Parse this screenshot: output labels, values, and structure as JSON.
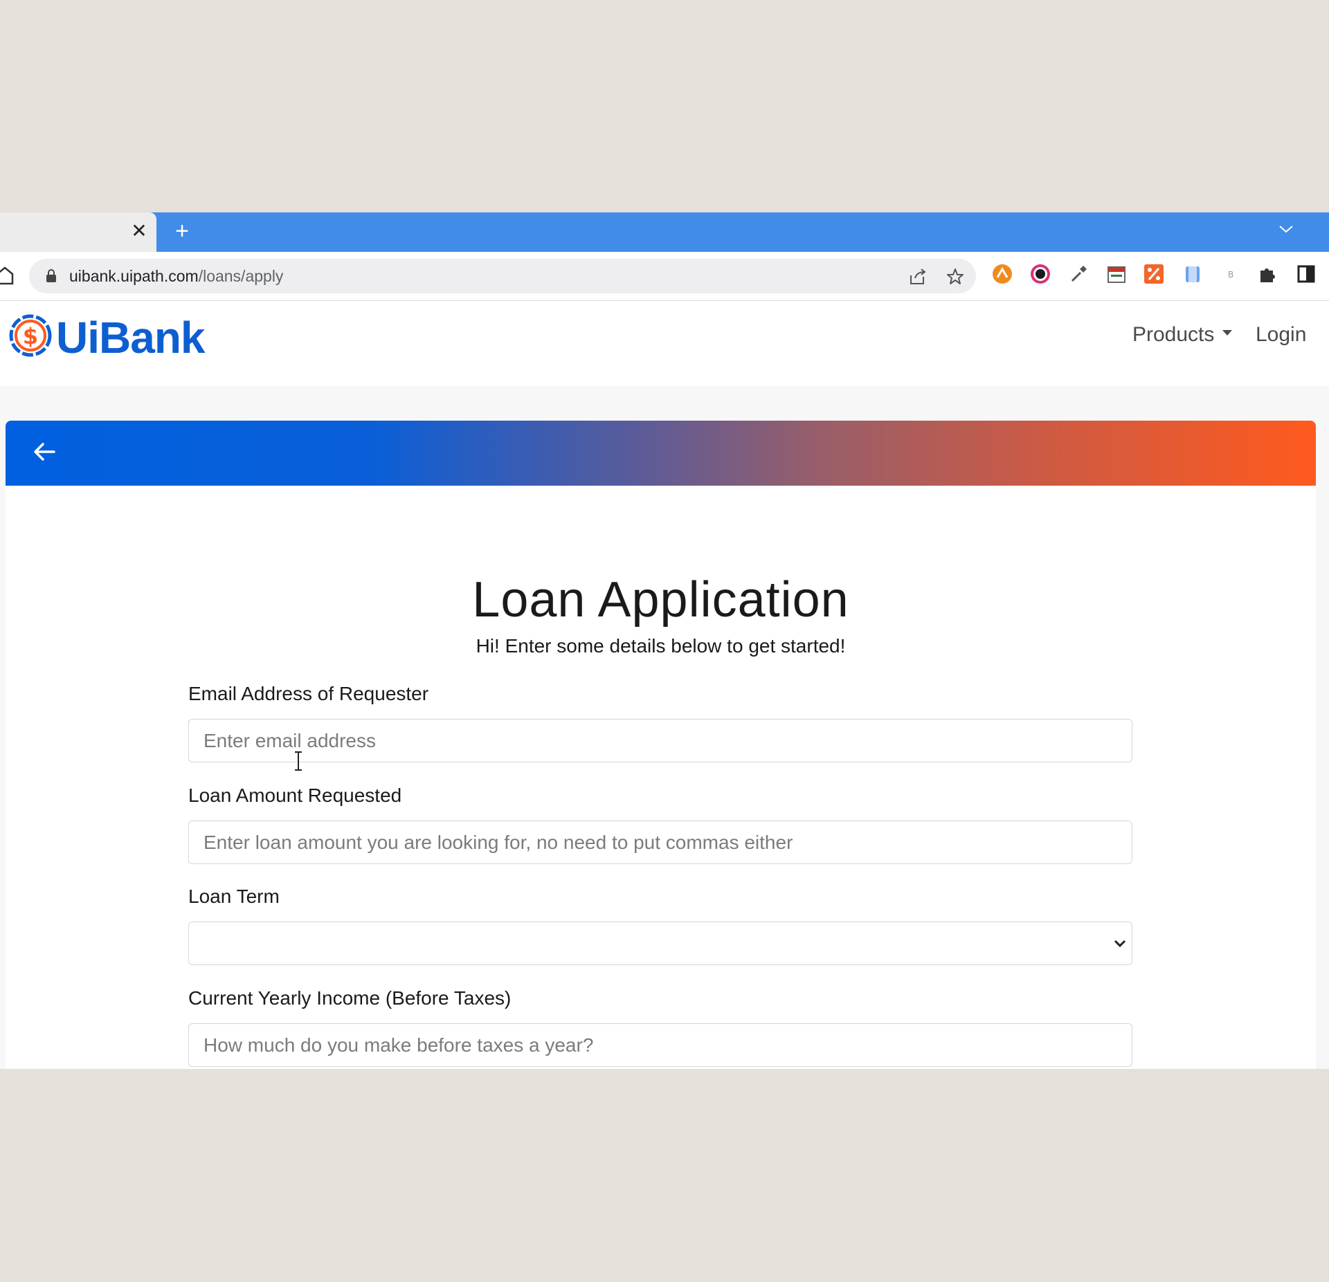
{
  "browser": {
    "tab_close": "✕",
    "new_tab": "+",
    "url_host": "uibank.uipath.com",
    "url_path": "/loans/apply"
  },
  "header": {
    "logo_text": "UiBank",
    "logo_symbol": "$",
    "nav_products": "Products",
    "nav_login": "Login"
  },
  "page": {
    "title": "Loan Application",
    "subtitle": "Hi! Enter some details below to get started!"
  },
  "form": {
    "email_label": "Email Address of Requester",
    "email_placeholder": "Enter email address",
    "amount_label": "Loan Amount Requested",
    "amount_placeholder": "Enter loan amount you are looking for, no need to put commas either",
    "term_label": "Loan Term",
    "term_value": "",
    "income_label": "Current Yearly Income (Before Taxes)",
    "income_placeholder": "How much do you make before taxes a year?"
  },
  "colors": {
    "brand_blue": "#0d5fd1",
    "brand_orange": "#ff5a1e",
    "tab_strip": "#418ce9"
  },
  "icons": [
    "home-icon",
    "lock-icon",
    "share-icon",
    "star-icon",
    "chevron-down-icon",
    "back-arrow-icon",
    "puzzle-icon",
    "side-panel-icon"
  ]
}
